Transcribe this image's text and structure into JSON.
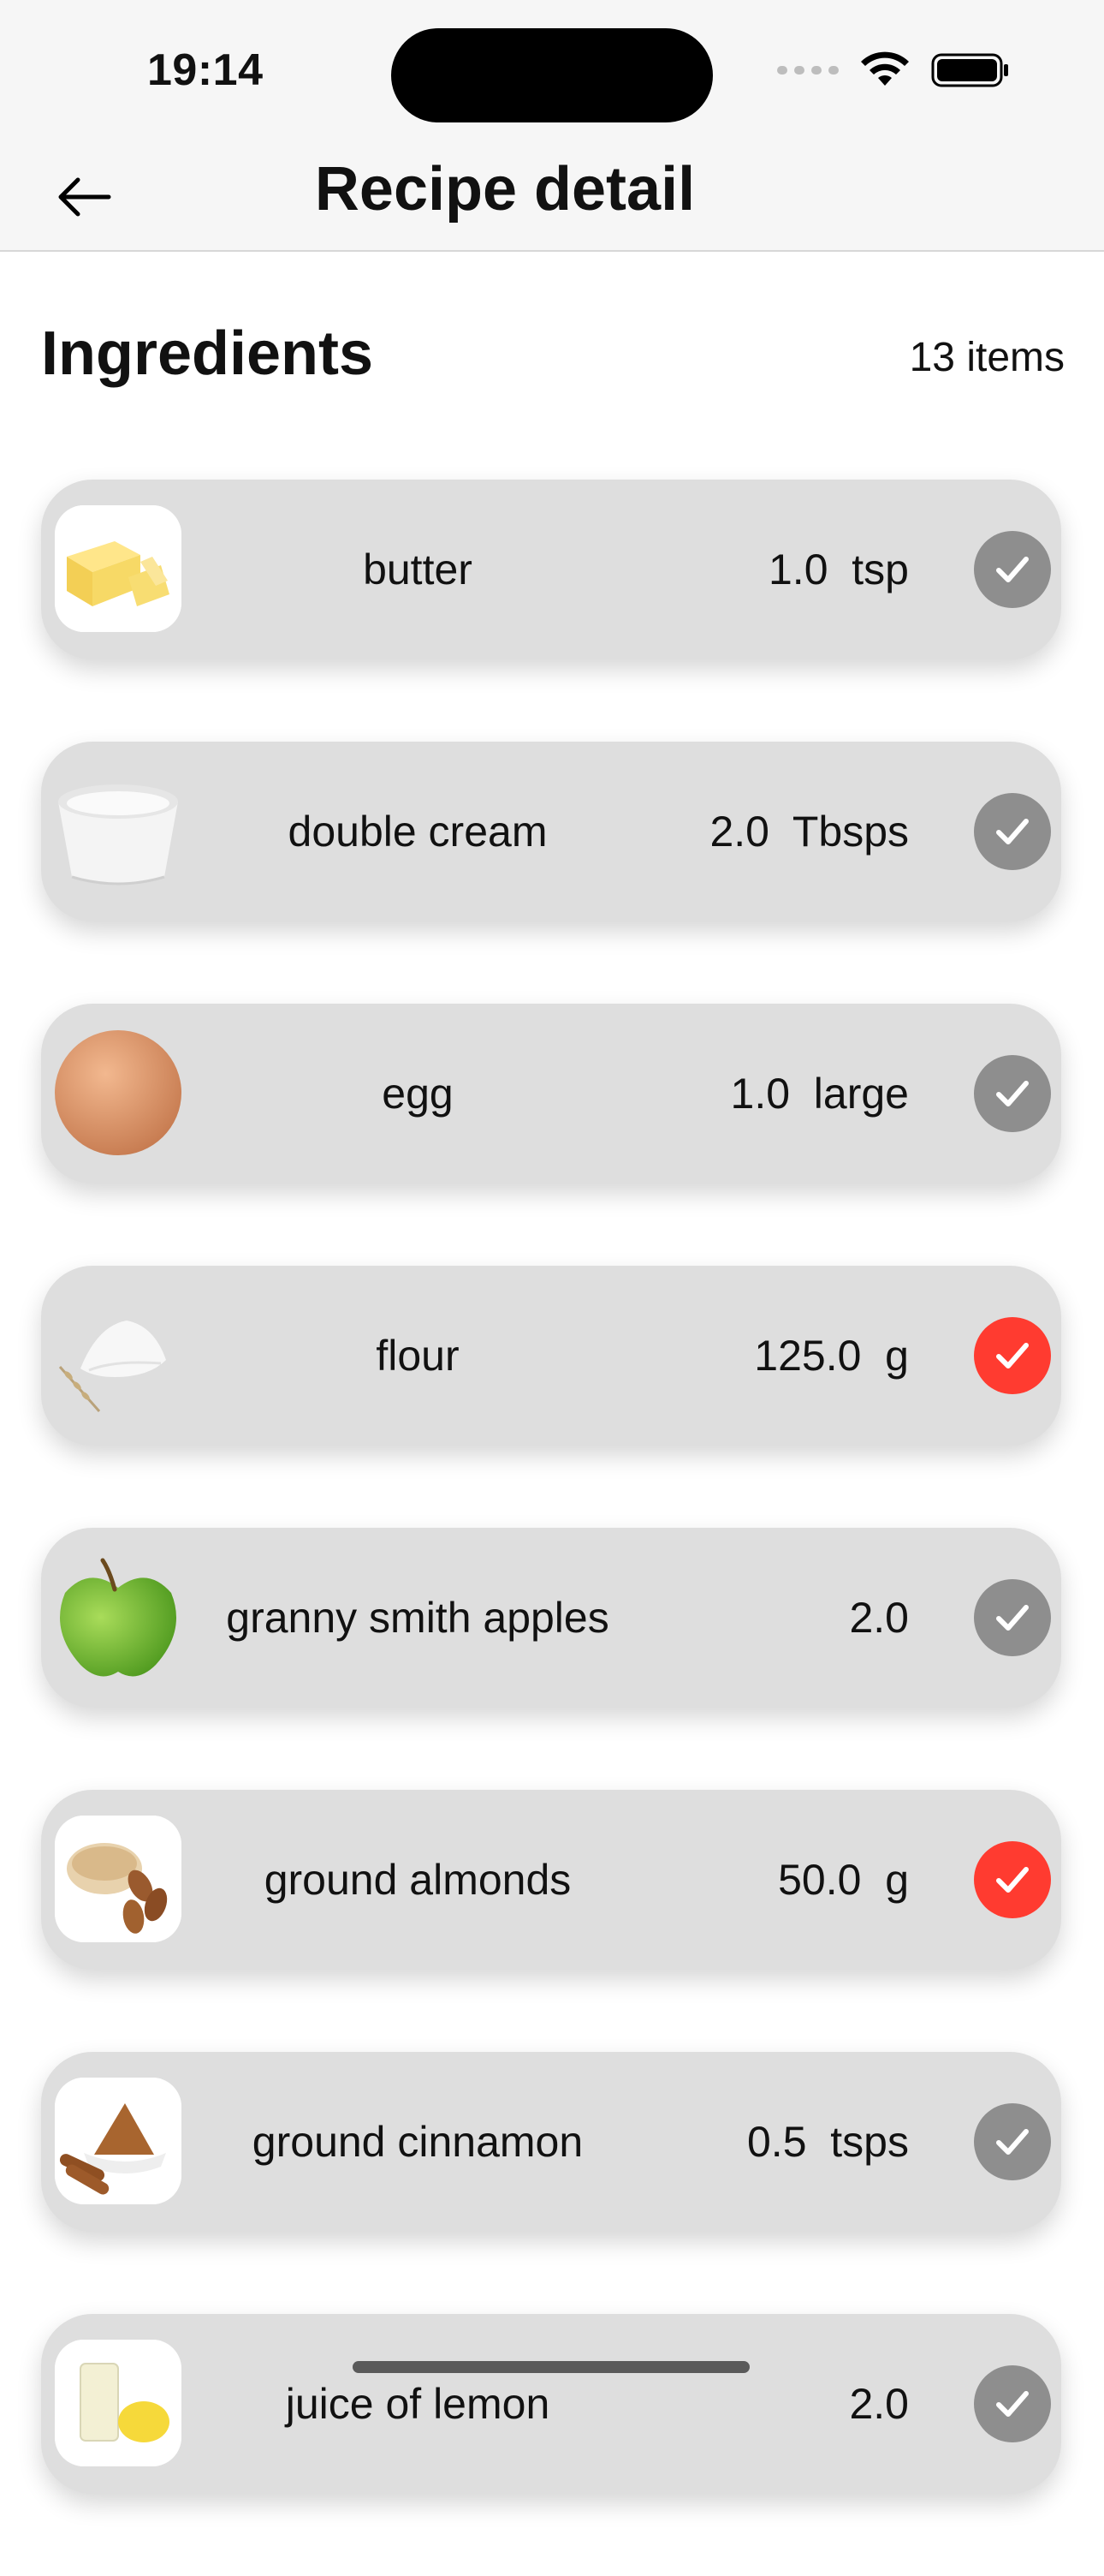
{
  "status_bar": {
    "time": "19:14"
  },
  "nav": {
    "title": "Recipe detail",
    "back_icon": "arrow-left-icon"
  },
  "section": {
    "title": "Ingredients",
    "count": "13 items"
  },
  "colors": {
    "card_bg": "#dedede",
    "check_off": "#8e8e8e",
    "check_on": "#ff3b30"
  },
  "ingredients": [
    {
      "name": "butter",
      "quantity": "1.0  tsp",
      "checked": false,
      "icon": "butter-image"
    },
    {
      "name": "double cream",
      "quantity": "2.0  Tbsps",
      "checked": false,
      "icon": "cream-bowl-image"
    },
    {
      "name": "egg",
      "quantity": "1.0  large",
      "checked": false,
      "icon": "egg-image"
    },
    {
      "name": "flour",
      "quantity": "125.0  g",
      "checked": true,
      "icon": "flour-image"
    },
    {
      "name": "granny smith apples",
      "quantity": "2.0",
      "checked": false,
      "icon": "green-apple-image"
    },
    {
      "name": "ground almonds",
      "quantity": "50.0  g",
      "checked": true,
      "icon": "almonds-image"
    },
    {
      "name": "ground cinnamon",
      "quantity": "0.5  tsps",
      "checked": false,
      "icon": "cinnamon-image"
    },
    {
      "name": "juice of lemon",
      "quantity": "2.0",
      "checked": false,
      "icon": "lemon-juice-image"
    }
  ]
}
